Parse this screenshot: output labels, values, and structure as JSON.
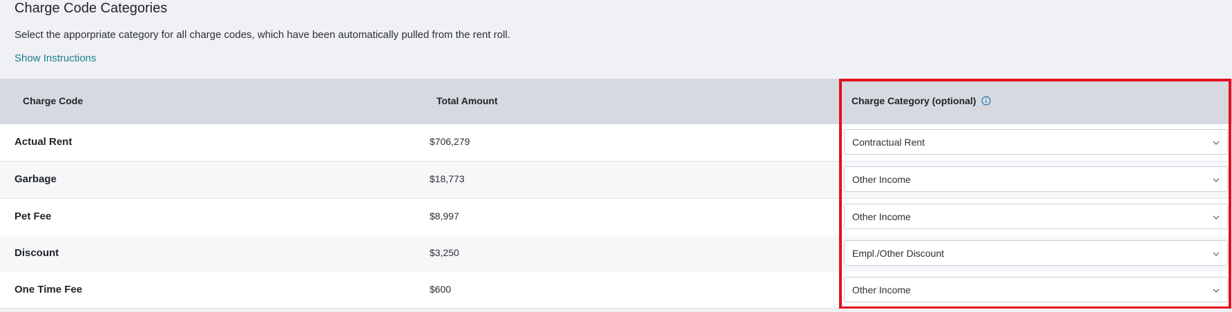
{
  "header": {
    "title": "Charge Code Categories",
    "subtitle": "Select the apporpriate category for all charge codes, which have been automatically pulled from the rent roll.",
    "instructions_link": "Show Instructions"
  },
  "table": {
    "columns": {
      "charge_code": "Charge Code",
      "total_amount": "Total Amount",
      "charge_category": "Charge Category (optional)"
    },
    "rows": [
      {
        "code": "Actual Rent",
        "amount": "$706,279",
        "category": "Contractual Rent"
      },
      {
        "code": "Garbage",
        "amount": "$18,773",
        "category": "Other Income"
      },
      {
        "code": "Pet Fee",
        "amount": "$8,997",
        "category": "Other Income"
      },
      {
        "code": "Discount",
        "amount": "$3,250",
        "category": "Empl./Other Discount"
      },
      {
        "code": "One Time Fee",
        "amount": "$600",
        "category": "Other Income"
      }
    ]
  },
  "icons": {
    "info": "info-circle-icon",
    "dropdown": "chevron-down-icon"
  },
  "colors": {
    "link": "#1a7f8e",
    "header_bg": "#d6dae0",
    "highlight": "#e3101f",
    "page_bg": "#f0f1f4"
  }
}
